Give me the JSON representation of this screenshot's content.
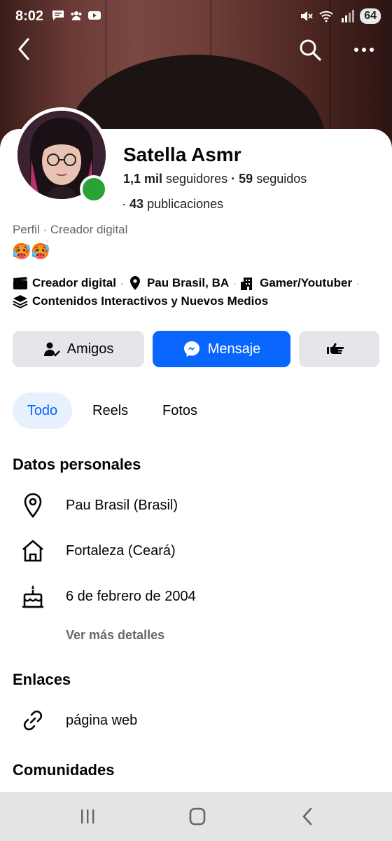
{
  "status": {
    "time": "8:02",
    "battery": "64",
    "icons_left": [
      "chat-icon",
      "groups-icon",
      "youtube-icon"
    ],
    "icons_right": [
      "mute-icon",
      "wifi-icon",
      "signal-icon"
    ]
  },
  "nav": {
    "back_icon": "back-arrow-icon",
    "search_icon": "search-icon",
    "more_icon": "more-dots-icon"
  },
  "profile": {
    "name": "Satella Asmr",
    "followers_count": "1,1 mil",
    "followers_label": "seguidores",
    "dot": "·",
    "following_count": "59",
    "following_label": "seguidos",
    "posts_prefix": "·",
    "posts_count": "43",
    "posts_label": "publicaciones",
    "category": "Perfil · Creador digital",
    "bio_emojis": "🥵🥵",
    "online": true
  },
  "details": {
    "items": [
      {
        "icon": "clapperboard-icon",
        "label": "Creador digital"
      },
      {
        "icon": "location-pin-icon",
        "label": "Pau Brasil, BA"
      },
      {
        "icon": "building-icon",
        "label": "Gamer/Youtuber"
      },
      {
        "icon": "layers-icon",
        "label": "Contenidos Interactivos y Nuevos Medios"
      }
    ],
    "separator": "·"
  },
  "actions": {
    "friends_label": "Amigos",
    "message_label": "Mensaje",
    "more_icon": "pointing-hand-icon"
  },
  "tabs": [
    {
      "label": "Todo",
      "active": true
    },
    {
      "label": "Reels",
      "active": false
    },
    {
      "label": "Fotos",
      "active": false
    }
  ],
  "personal": {
    "title": "Datos personales",
    "items": [
      {
        "icon": "location-pin-icon",
        "text": "Pau Brasil (Brasil)"
      },
      {
        "icon": "home-icon",
        "text": "Fortaleza (Ceará)"
      },
      {
        "icon": "cake-icon",
        "text": "6 de febrero de 2004"
      }
    ],
    "see_more": "Ver más detalles"
  },
  "links": {
    "title": "Enlaces",
    "items": [
      {
        "icon": "link-icon",
        "text": "página web"
      }
    ]
  },
  "communities": {
    "title": "Comunidades"
  },
  "colors": {
    "primary_blue": "#0866ff",
    "secondary_gray": "#e4e6eb",
    "online_green": "#2aa336",
    "muted_text": "#65676b"
  },
  "system_nav": [
    "recents-icon",
    "home-circle-icon",
    "back-chevron-icon"
  ]
}
